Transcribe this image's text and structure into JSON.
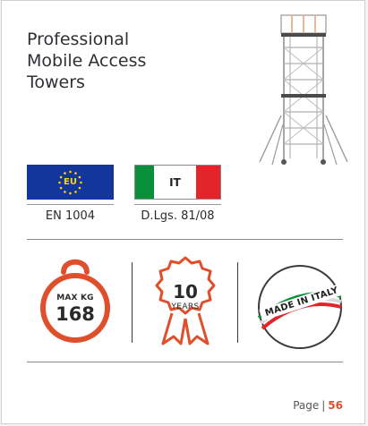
{
  "product": {
    "title": "Professional\nMobile Access\nTowers"
  },
  "certifications": [
    {
      "flag": "EU",
      "norm": "EN 1004",
      "colors": [
        "#12369c",
        "#ffd400"
      ]
    },
    {
      "flag": "IT",
      "norm": "D.Lgs. 81/08",
      "colors": [
        "#0a8f3b",
        "#ffffff",
        "#e2252a"
      ]
    }
  ],
  "badges": {
    "max_load_label": "MAX KG",
    "max_load_value": "168",
    "warranty_value": "10",
    "warranty_label": "YEARS",
    "made_in": "MADE IN ITALY"
  },
  "footer": {
    "page_label": "Page",
    "page_separator": "|",
    "page_number": "56",
    "accent_color": "#e04f2c"
  },
  "icons": [
    "scaffold-tower-image",
    "eu-flag-icon",
    "italy-flag-icon",
    "weight-icon",
    "warranty-rosette-icon",
    "made-in-italy-stamp-icon"
  ]
}
